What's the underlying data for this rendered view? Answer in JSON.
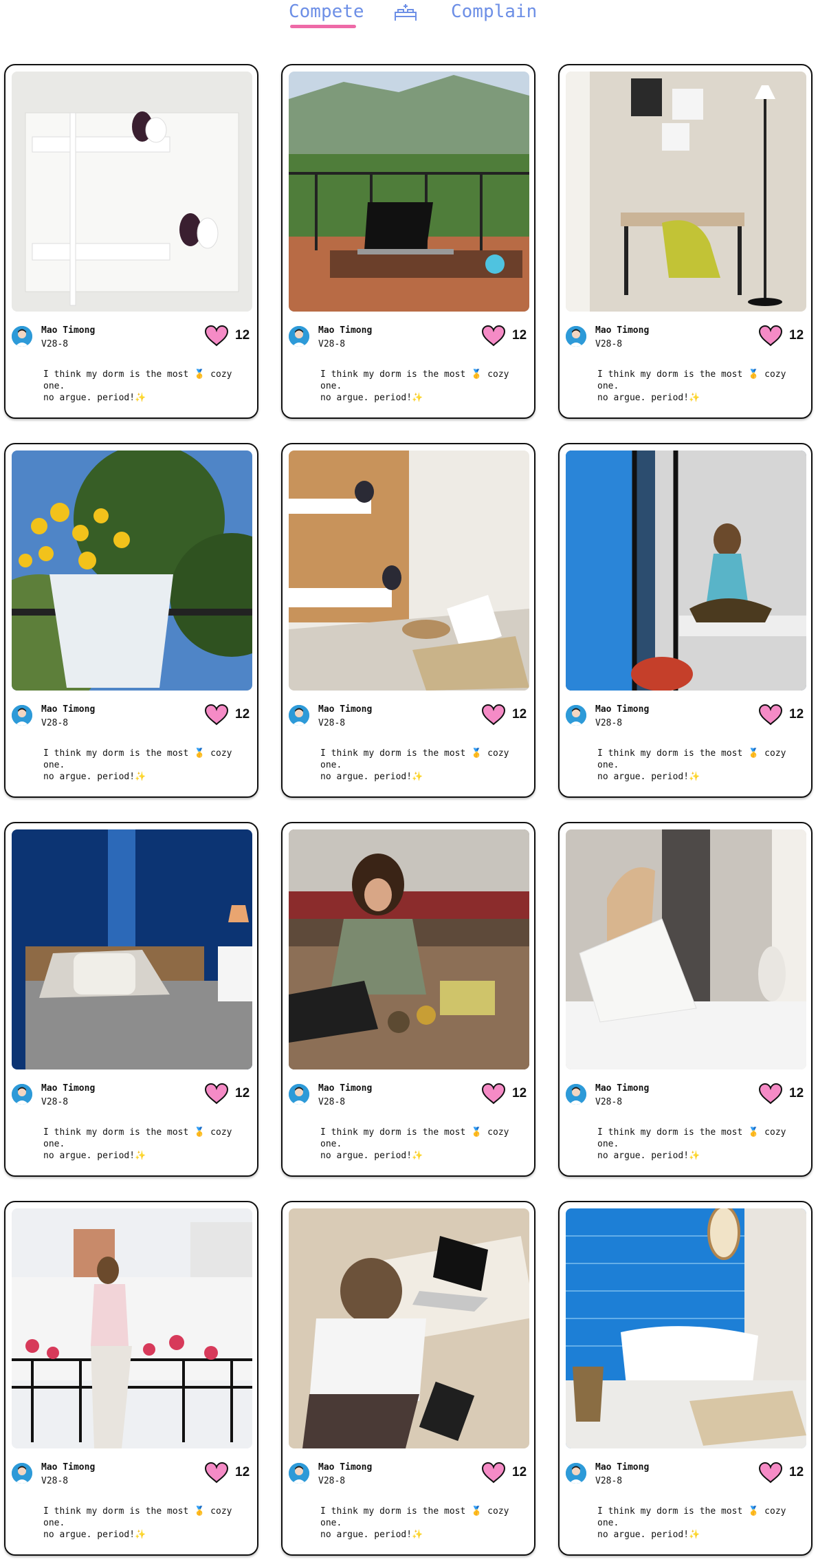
{
  "nav": {
    "compete_label": "Compete",
    "complain_label": "Complain",
    "center_icon": "bed-icon",
    "accent_color": "#6d8fe6",
    "underline_color": "#ee6aa7"
  },
  "posts": [
    {
      "image": "white-bunk-beds",
      "user": "Mao Timong",
      "room": "V28-8",
      "likes": "12",
      "caption": "I think my dorm is the most 🥇 cozy one.\nno argue. period!✨"
    },
    {
      "image": "balcony-laptop-mountain-view",
      "user": "Mao Timong",
      "room": "V28-8",
      "likes": "12",
      "caption": "I think my dorm is the most 🥇 cozy one.\nno argue. period!✨"
    },
    {
      "image": "desk-yellow-chair-floor-lamp",
      "user": "Mao Timong",
      "room": "V28-8",
      "likes": "12",
      "caption": "I think my dorm is the most 🥇 cozy one.\nno argue. period!✨"
    },
    {
      "image": "yellow-flowers-balcony-planter",
      "user": "Mao Timong",
      "room": "V28-8",
      "likes": "12",
      "caption": "I think my dorm is the most 🥇 cozy one.\nno argue. period!✨"
    },
    {
      "image": "wooden-bunk-beds-rug",
      "user": "Mao Timong",
      "room": "V28-8",
      "likes": "12",
      "caption": "I think my dorm is the most 🥇 cozy one.\nno argue. period!✨"
    },
    {
      "image": "woman-on-bunk-blue-curtains",
      "user": "Mao Timong",
      "room": "V28-8",
      "likes": "12",
      "caption": "I think my dorm is the most 🥇 cozy one.\nno argue. period!✨"
    },
    {
      "image": "bed-blue-wall",
      "user": "Mao Timong",
      "room": "V28-8",
      "likes": "12",
      "caption": "I think my dorm is the most 🥇 cozy one.\nno argue. period!✨"
    },
    {
      "image": "woman-studying-on-floor",
      "user": "Mao Timong",
      "room": "V28-8",
      "likes": "12",
      "caption": "I think my dorm is the most 🥇 cozy one.\nno argue. period!✨"
    },
    {
      "image": "woman-in-robe-on-bed",
      "user": "Mao Timong",
      "room": "V28-8",
      "likes": "12",
      "caption": "I think my dorm is the most 🥇 cozy one.\nno argue. period!✨"
    },
    {
      "image": "woman-on-flower-balcony",
      "user": "Mao Timong",
      "room": "V28-8",
      "likes": "12",
      "caption": "I think my dorm is the most 🥇 cozy one.\nno argue. period!✨"
    },
    {
      "image": "boy-with-headphones-laptop",
      "user": "Mao Timong",
      "room": "V28-8",
      "likes": "12",
      "caption": "I think my dorm is the most 🥇 cozy one.\nno argue. period!✨"
    },
    {
      "image": "blue-tile-bathtub",
      "user": "Mao Timong",
      "room": "V28-8",
      "likes": "12",
      "caption": "I think my dorm is the most 🥇 cozy one.\nno argue. period!✨"
    }
  ],
  "icons": {
    "like": "heart-icon",
    "avatar": "avatar-icon"
  },
  "colors": {
    "heart_fill": "#f58bc6",
    "avatar_bg": "#2d9ad8"
  }
}
